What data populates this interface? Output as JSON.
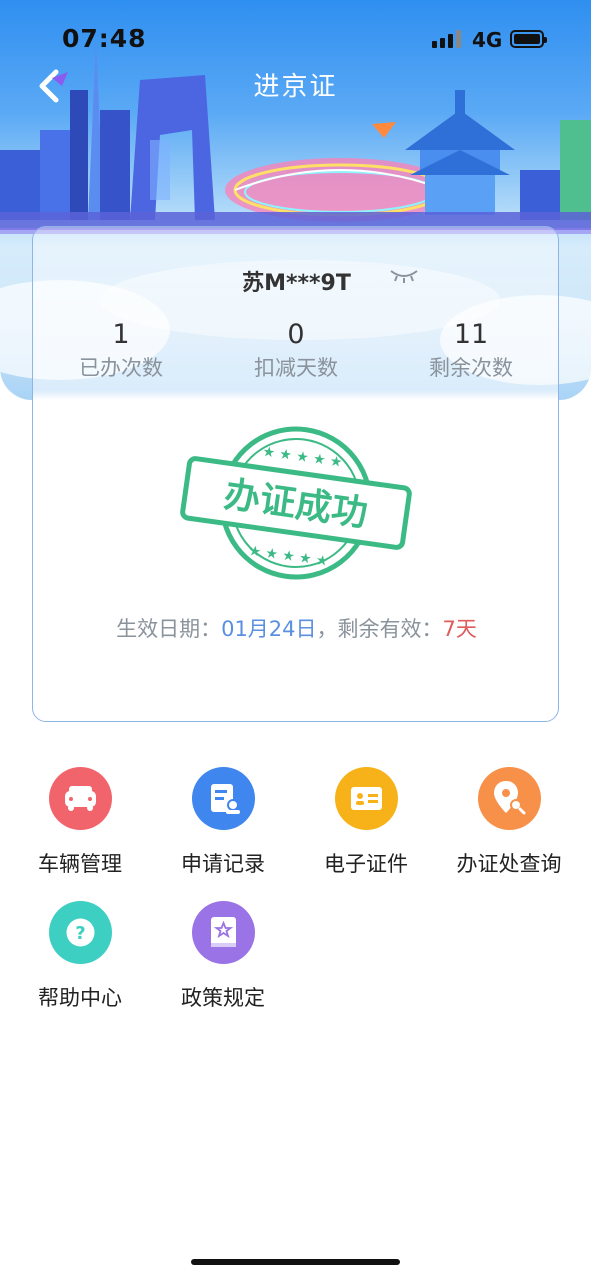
{
  "status_bar": {
    "time": "07:48",
    "network": "4G"
  },
  "header": {
    "title": "进京证"
  },
  "card": {
    "plate": "苏M***9T",
    "stats": [
      {
        "value": "1",
        "label": "已办次数"
      },
      {
        "value": "0",
        "label": "扣减天数"
      },
      {
        "value": "11",
        "label": "剩余次数"
      }
    ],
    "stamp_text": "办证成功",
    "validity": {
      "prefix": "生效日期：",
      "date": "01月24日",
      "sep": "，剩余有效：",
      "remaining": "7天"
    }
  },
  "menu": [
    {
      "label": "车辆管理",
      "icon": "car-icon",
      "color": "#f2646c"
    },
    {
      "label": "申请记录",
      "icon": "record-icon",
      "color": "#3f86ee"
    },
    {
      "label": "电子证件",
      "icon": "id-card-icon",
      "color": "#f8b219"
    },
    {
      "label": "办证处查询",
      "icon": "location-search-icon",
      "color": "#f7914a"
    },
    {
      "label": "帮助中心",
      "icon": "help-icon",
      "color": "#3ecfc3"
    },
    {
      "label": "政策规定",
      "icon": "policy-book-icon",
      "color": "#9a73e6"
    }
  ]
}
